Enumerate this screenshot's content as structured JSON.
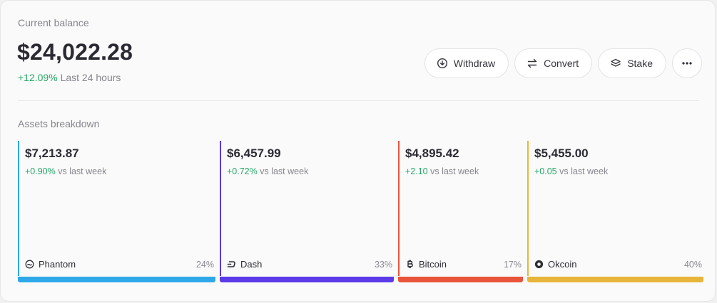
{
  "balance": {
    "label": "Current balance",
    "value": "$24,022.28",
    "change": "+12.09%",
    "period": "Last 24 hours"
  },
  "actions": {
    "withdraw": "Withdraw",
    "convert": "Convert",
    "stake": "Stake",
    "more_icon": "more-icon"
  },
  "breakdown": {
    "label": "Assets breakdown",
    "assets": [
      {
        "amount": "$7,213.87",
        "change": "+0.90%",
        "period": "vs last week",
        "name": "Phantom",
        "percent": "24%",
        "icon": "phantom-icon",
        "color": "#2ea8e8"
      },
      {
        "amount": "$6,457.99",
        "change": "+0.72%",
        "period": "vs last week",
        "name": "Dash",
        "percent": "33%",
        "icon": "dash-icon",
        "color": "#5b3ae8"
      },
      {
        "amount": "$4,895.42",
        "change": "+2.10",
        "period": "vs last week",
        "name": "Bitcoin",
        "percent": "17%",
        "icon": "bitcoin-icon",
        "color": "#e8553a"
      },
      {
        "amount": "$5,455.00",
        "change": "+0.05",
        "period": "vs last week",
        "name": "Okcoin",
        "percent": "40%",
        "icon": "okcoin-icon",
        "color": "#e8b53a"
      }
    ]
  }
}
